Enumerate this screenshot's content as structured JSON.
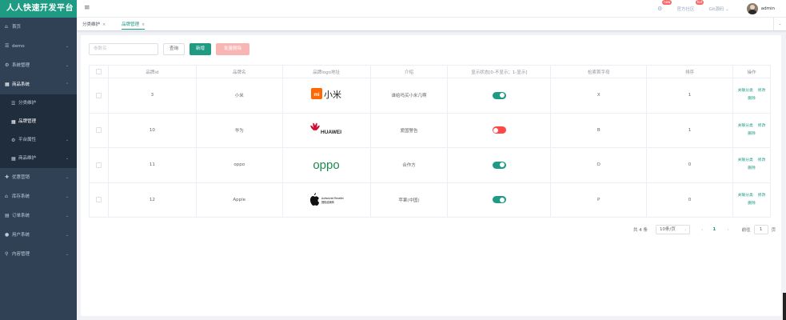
{
  "app": {
    "title": "人人快速开发平台"
  },
  "sidebar": {
    "items": [
      {
        "label": "首页",
        "icon": "home-icon",
        "glyph": "⌂",
        "arrow": ""
      },
      {
        "label": "demo",
        "icon": "menu-icon",
        "glyph": "☰",
        "arrow": "⌄"
      },
      {
        "label": "系统管理",
        "icon": "settings-icon",
        "glyph": "⚙",
        "arrow": "⌄"
      },
      {
        "label": "商品系统",
        "icon": "grid-icon",
        "glyph": "▦",
        "arrow": "⌃",
        "open": true
      },
      {
        "label": "优惠营销",
        "icon": "coupon-icon",
        "glyph": "✚",
        "arrow": "⌄"
      },
      {
        "label": "库存系统",
        "icon": "warehouse-icon",
        "glyph": "⌂",
        "arrow": "⌄"
      },
      {
        "label": "订单系统",
        "icon": "order-icon",
        "glyph": "▤",
        "arrow": "⌄"
      },
      {
        "label": "用户系统",
        "icon": "user-icon",
        "glyph": "●",
        "arrow": "⌄"
      },
      {
        "label": "内容管理",
        "icon": "search-icon",
        "glyph": "⚲",
        "arrow": "⌄"
      }
    ],
    "sub_items": [
      {
        "label": "分类维护",
        "glyph": "☰",
        "arrow": ""
      },
      {
        "label": "品牌管理",
        "glyph": "▦",
        "arrow": "",
        "active": true
      },
      {
        "label": "平台属性",
        "glyph": "⚙",
        "arrow": "⌄"
      },
      {
        "label": "商品维护",
        "glyph": "▦",
        "arrow": "⌄"
      }
    ]
  },
  "topbar": {
    "hamburger": "≡",
    "links": [
      {
        "label": "官方社区",
        "badge": "hot"
      },
      {
        "label": "Git源码",
        "arrow": "⌄"
      }
    ],
    "gear_badge": "new",
    "admin": "admin"
  },
  "tabs": [
    {
      "label": "分类维护",
      "close": "×"
    },
    {
      "label": "品牌管理",
      "close": "×",
      "active": true
    }
  ],
  "toolbar": {
    "search_placeholder": "参数名",
    "query_label": "查询",
    "add_label": "新增",
    "batch_delete_label": "批量删除"
  },
  "table": {
    "headers": [
      "品牌id",
      "品牌名",
      "品牌logo地址",
      "介绍",
      "显示状态[0-不显示；1-显示]",
      "检索首字母",
      "排序",
      "操作"
    ],
    "rows": [
      {
        "id": "3",
        "name": "小米",
        "logo": "xiaomi",
        "intro": "谁给吗买小米几啊",
        "status": true,
        "letter": "X",
        "sort": "1"
      },
      {
        "id": "10",
        "name": "华为",
        "logo": "huawei",
        "intro": "爱国警告",
        "status": false,
        "letter": "B",
        "sort": "1"
      },
      {
        "id": "11",
        "name": "oppo",
        "logo": "oppo",
        "intro": "合作方",
        "status": true,
        "letter": "O",
        "sort": "0"
      },
      {
        "id": "12",
        "name": "Apple",
        "logo": "apple",
        "intro": "苹果(中国)",
        "status": true,
        "letter": "P",
        "sort": "0"
      }
    ],
    "ops": {
      "relate": "关联分类",
      "edit": "修改",
      "delete": "删除"
    }
  },
  "logos": {
    "xiaomi_text": "小米",
    "xiaomi_mi": "mi",
    "huawei_text": "HUAWEI",
    "oppo_text": "oppo",
    "apple_line1": "Authorized Reseller",
    "apple_line2": "授权经销商"
  },
  "pagination": {
    "total": "共 4 条",
    "page_size": "10条/页",
    "prev": "‹",
    "current": "1",
    "next": "›",
    "goto_label": "前往",
    "goto_value": "1",
    "page_unit": "页"
  },
  "colors": {
    "primary": "#1f9b84",
    "sidebar": "#304156",
    "danger": "#ff4949"
  }
}
